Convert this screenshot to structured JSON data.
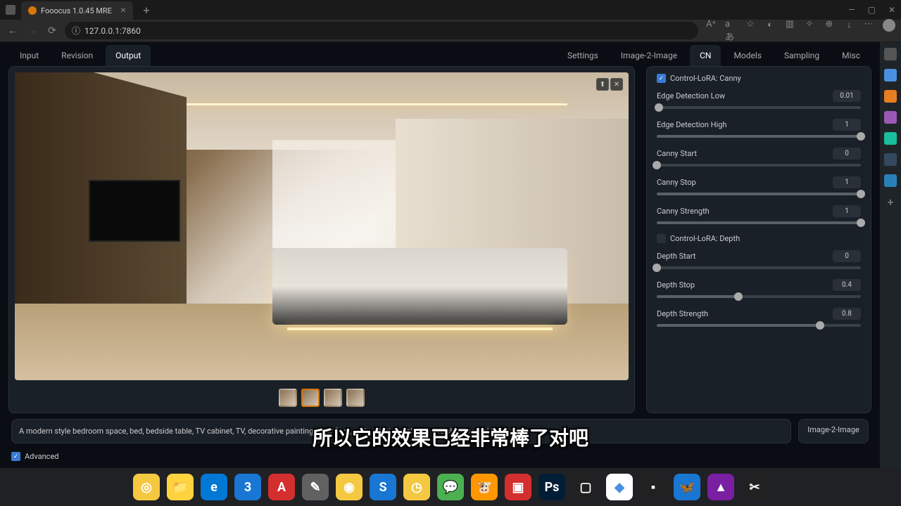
{
  "browser": {
    "tab_title": "Fooocus 1.0.45 MRE",
    "url": "127.0.0.1:7860"
  },
  "left_tabs": [
    "Input",
    "Revision",
    "Output"
  ],
  "left_active": 2,
  "right_tabs": [
    "Settings",
    "Image-2-Image",
    "CN",
    "Models",
    "Sampling",
    "Misc"
  ],
  "right_active": 2,
  "image_controls": {
    "upload": "⬆",
    "close": "✕"
  },
  "thumbnails": 4,
  "thumb_selected": 1,
  "cn": {
    "canny_checked": true,
    "canny_label": "Control-LoRA: Canny",
    "depth_checked": false,
    "depth_label": "Control-LoRA: Depth",
    "sliders": [
      {
        "label": "Edge Detection Low",
        "value": "0.01",
        "pct": 1
      },
      {
        "label": "Edge Detection High",
        "value": "1",
        "pct": 100
      },
      {
        "label": "Canny Start",
        "value": "0",
        "pct": 0
      },
      {
        "label": "Canny Stop",
        "value": "1",
        "pct": 100
      },
      {
        "label": "Canny Strength",
        "value": "1",
        "pct": 100
      }
    ],
    "depth_sliders": [
      {
        "label": "Depth Start",
        "value": "0",
        "pct": 0
      },
      {
        "label": "Depth Stop",
        "value": "0.4",
        "pct": 40
      },
      {
        "label": "Depth Strength",
        "value": "0.8",
        "pct": 80
      }
    ]
  },
  "prompt": "A modern style bedroom space, bed, bedside table, TV cabinet, TV, decorative painting, floor floor, real material, real light and shadow, real texture",
  "img2img_label": "Image-2-Image",
  "advanced_checked": true,
  "advanced_label": "Advanced",
  "subtitle": "所以它的效果已经非常棒了对吧",
  "dock": [
    {
      "bg": "#f5c842",
      "txt": "◎"
    },
    {
      "bg": "#ffd23f",
      "txt": "📁"
    },
    {
      "bg": "#0078d4",
      "txt": "e"
    },
    {
      "bg": "#1976d2",
      "txt": "3"
    },
    {
      "bg": "#d32f2f",
      "txt": "A"
    },
    {
      "bg": "#616161",
      "txt": "✎"
    },
    {
      "bg": "#f5c842",
      "txt": "◉"
    },
    {
      "bg": "#1976d2",
      "txt": "S"
    },
    {
      "bg": "#f5c842",
      "txt": "◷"
    },
    {
      "bg": "#4caf50",
      "txt": "💬"
    },
    {
      "bg": "#ff9800",
      "txt": "🐮"
    },
    {
      "bg": "#d32f2f",
      "txt": "▣"
    },
    {
      "bg": "#001e36",
      "txt": "Ps"
    },
    {
      "bg": "#212121",
      "txt": "▢"
    },
    {
      "bg": "#ffffff",
      "txt": "◆"
    },
    {
      "bg": "#212121",
      "txt": "▪"
    },
    {
      "bg": "#1976d2",
      "txt": "🦋"
    },
    {
      "bg": "#7b1fa2",
      "txt": "▲"
    },
    {
      "bg": "#212121",
      "txt": "✂"
    }
  ],
  "sidebar_icons": [
    {
      "bg": "#555"
    },
    {
      "bg": "#4a90e2"
    },
    {
      "bg": "#e67e22"
    },
    {
      "bg": "#9b59b6"
    },
    {
      "bg": "#1abc9c"
    },
    {
      "bg": "#34495e"
    },
    {
      "bg": "#2980b9"
    }
  ]
}
